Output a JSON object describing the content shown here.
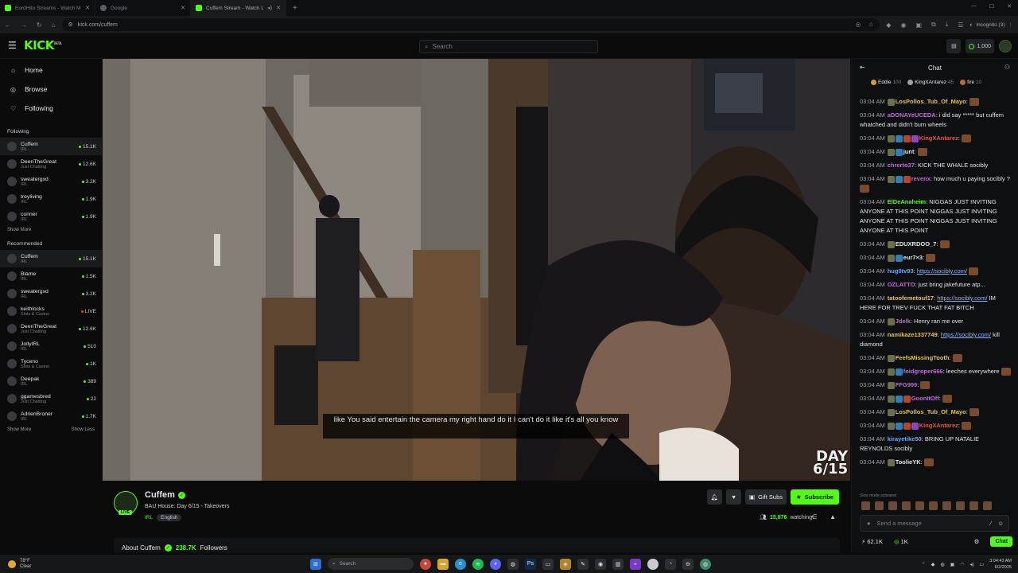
{
  "browser": {
    "tabs": [
      {
        "title": "EordHito Streams - Watch Me on K",
        "active": false
      },
      {
        "title": "Google",
        "active": false
      },
      {
        "title": "Cuffem Stream - Watch Liv",
        "active": true
      }
    ],
    "url": "kick.com/cuffem",
    "profile": "Incognito (3)"
  },
  "header": {
    "logo": "KICK",
    "logo_badge": "BETA",
    "search_placeholder": "Search",
    "points": "1,000"
  },
  "sidebar": {
    "nav": [
      {
        "label": "Home",
        "icon": "home-icon"
      },
      {
        "label": "Browse",
        "icon": "compass-icon"
      },
      {
        "label": "Following",
        "icon": "heart-icon"
      }
    ],
    "following_title": "Following",
    "following": [
      {
        "name": "Cuffem",
        "cat": "IRL",
        "viewers": "15.1K"
      },
      {
        "name": "DeenTheGreat",
        "cat": "Just Chatting",
        "viewers": "12.6K"
      },
      {
        "name": "sweatergxd",
        "cat": "IRL",
        "viewers": "3.2K"
      },
      {
        "name": "treyliving",
        "cat": "IRL",
        "viewers": "1.9K"
      },
      {
        "name": "conner",
        "cat": "IRL",
        "viewers": "1.9K"
      }
    ],
    "show_more": "Show More",
    "recommended_title": "Recommended",
    "recommended": [
      {
        "name": "Cuffem",
        "cat": "IRL",
        "viewers": "15.1K"
      },
      {
        "name": "Blame",
        "cat": "IRL",
        "viewers": "1.5K"
      },
      {
        "name": "sweatergxd",
        "cat": "IRL",
        "viewers": "3.2K"
      },
      {
        "name": "keithlocks",
        "cat": "Slots & Casino",
        "viewers": "LIVE"
      },
      {
        "name": "DeenTheGreat",
        "cat": "Just Chatting",
        "viewers": "12.6K"
      },
      {
        "name": "JollyIRL",
        "cat": "IRL",
        "viewers": "510"
      },
      {
        "name": "Tyceno",
        "cat": "Slots & Casino",
        "viewers": "1K"
      },
      {
        "name": "Deepak",
        "cat": "IRL",
        "viewers": "389"
      },
      {
        "name": "ggamesbred",
        "cat": "Just Chatting",
        "viewers": "22"
      },
      {
        "name": "AdrienBroner",
        "cat": "IRL",
        "viewers": "1.7K"
      }
    ],
    "show_more_2": "Show More",
    "show_less": "Show Less"
  },
  "video": {
    "caption": "like You said entertain the camera my right hand do it I can't do it like it's all you know",
    "overlay_line1": "DAY",
    "overlay_line2": "6/15"
  },
  "stream": {
    "name": "Cuffem",
    "live_badge": "LIVE",
    "title": "BAU House: Day 6/15 - Takeovers",
    "category": "IRL",
    "tag": "English",
    "gift_subs": "Gift Subs",
    "subscribe": "Subscribe",
    "watching_count": "15,076",
    "watching_label": "watching",
    "about_label": "About Cuffem",
    "followers_count": "238.7K",
    "followers_label": "Followers"
  },
  "chat": {
    "title": "Chat",
    "gifters": [
      {
        "name": "Eddie",
        "count": "100"
      },
      {
        "name": "KingXAntarez",
        "count": "45"
      },
      {
        "name": "fire",
        "count": "10"
      }
    ],
    "messages": [
      {
        "time": "03:04 AM",
        "user": "LosPollos_Tub_Of_Mayo",
        "color": "#e6c34a",
        "text": ":",
        "badges": 1,
        "emote": true
      },
      {
        "time": "03:04 AM",
        "user": "aDONAYeUCEDA",
        "color": "#c06ad6",
        "text": ": i did say ***** but cuffem whatched and didn't burn wheels",
        "badges": 0,
        "emote": false
      },
      {
        "time": "03:04 AM",
        "user": "KingXAntarez",
        "color": "#e0584b",
        "text": ":",
        "badges": 4,
        "emote": true
      },
      {
        "time": "03:04 AM",
        "user": "junt",
        "color": "#e4e6e8",
        "text": ":",
        "badges": 2,
        "emote": true
      },
      {
        "time": "03:04 AM",
        "user": "chrerto37",
        "color": "#c06ad6",
        "text": ": KICK THE WHALE socibly",
        "badges": 0,
        "emote": false
      },
      {
        "time": "03:04 AM",
        "user": "revenx",
        "color": "#c06ad6",
        "text": ": how much u paying socibly ?",
        "badges": 3,
        "emote": true
      },
      {
        "time": "03:04 AM",
        "user": "ElDeAnaheim",
        "color": "#53fc18",
        "text": ": NIGGAS JUST INVITING ANYONE AT THIS POINT NIGGAS JUST INVITING ANYONE AT THIS POINT NIGGAS JUST INVITING ANYONE AT THIS POINT",
        "badges": 0,
        "emote": false
      },
      {
        "time": "03:04 AM",
        "user": "EDUXRDOO_7",
        "color": "#e4e6e8",
        "text": ":",
        "badges": 1,
        "emote": true
      },
      {
        "time": "03:04 AM",
        "user": "eur7×3",
        "color": "#e4e6e8",
        "text": ":",
        "badges": 2,
        "emote": true
      },
      {
        "time": "03:04 AM",
        "user": "hug0tv93",
        "color": "#6aa8ff",
        "text": ": ",
        "link": "https://socibly.com/",
        "badges": 0,
        "emote": true
      },
      {
        "time": "03:04 AM",
        "user": "OZLATTO",
        "color": "#c06ad6",
        "text": ": just bring jakefuture atp...",
        "badges": 0,
        "emote": false
      },
      {
        "time": "03:04 AM",
        "user": "tatoofemetouf17",
        "color": "#e6c34a",
        "text": ": ",
        "link": "https://socibly.com/",
        "after": " IM HERE FOR TREV FUCK THAT FAT BITCH",
        "badges": 0,
        "emote": false
      },
      {
        "time": "03:04 AM",
        "user": "Jdelk",
        "color": "#c06ad6",
        "text": ": Henry ran me over",
        "badges": 1,
        "emote": false
      },
      {
        "time": "03:04 AM",
        "user": "namikaze1337749",
        "color": "#e6c34a",
        "text": ": ",
        "link": "https://socibly.com/",
        "after": " kill diamond",
        "badges": 0,
        "emote": false
      },
      {
        "time": "03:04 AM",
        "user": "FeefsMissingTooth",
        "color": "#e6c34a",
        "text": ":",
        "badges": 1,
        "emote": true
      },
      {
        "time": "03:04 AM",
        "user": "foidgroper666",
        "color": "#c06ad6",
        "text": ": leeches everywhere",
        "badges": 2,
        "emote": true
      },
      {
        "time": "03:04 AM",
        "user": "FFG999",
        "color": "#c06ad6",
        "text": ":",
        "badges": 1,
        "emote": true
      },
      {
        "time": "03:04 AM",
        "user": "GoonItOff",
        "color": "#c06ad6",
        "text": ":",
        "badges": 3,
        "emote": true
      },
      {
        "time": "03:04 AM",
        "user": "LosPollos_Tub_Of_Mayo",
        "color": "#e6c34a",
        "text": ":",
        "badges": 1,
        "emote": true
      },
      {
        "time": "03:04 AM",
        "user": "KingXAntarez",
        "color": "#e0584b",
        "text": ":",
        "badges": 4,
        "emote": true
      },
      {
        "time": "03:04 AM",
        "user": "kirayetike50",
        "color": "#6aa8ff",
        "text": ": BRING UP NATALIE REYNOLDS socibly",
        "badges": 0,
        "emote": false
      },
      {
        "time": "03:04 AM",
        "user": "ToolieYK",
        "color": "#e4e6e8",
        "text": ":",
        "badges": 1,
        "emote": true
      }
    ],
    "slow_mode": "Slow mode activated",
    "input_placeholder": "Send a message",
    "footer_count_1": "62.1K",
    "footer_count_2": "1K",
    "chat_button": "Chat"
  },
  "taskbar": {
    "temp": "78°F",
    "weather": "Clear",
    "search": "Search",
    "time": "3:04:43 AM",
    "date": "6/2/2025"
  },
  "colors": {
    "accent": "#53fc18",
    "bg": "#0b0b0c"
  }
}
